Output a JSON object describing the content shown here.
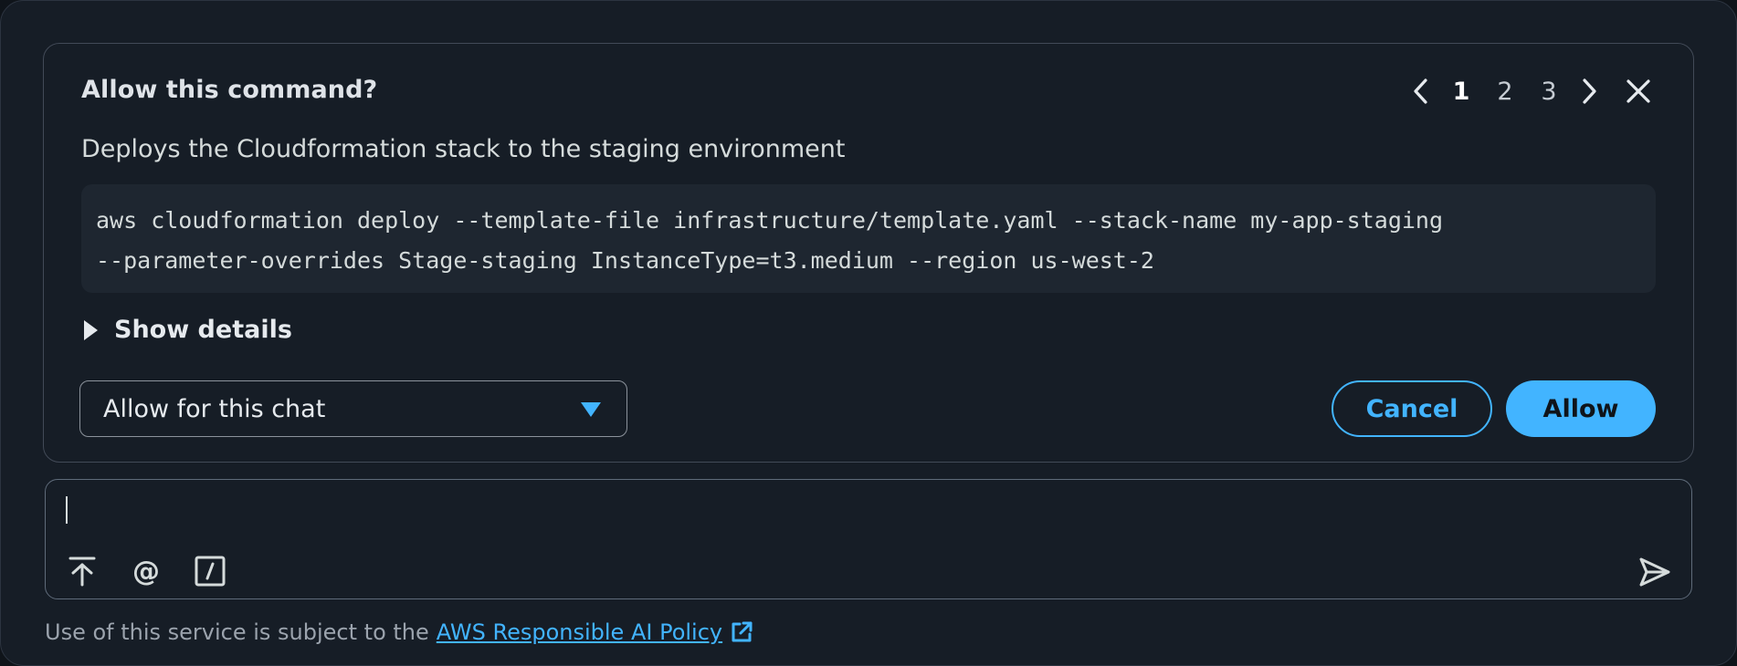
{
  "prompt": {
    "title": "Allow this command?",
    "description": "Deploys the Cloudformation stack to the staging environment",
    "command_line_1": "aws cloudformation deploy --template-file infrastructure/template.yaml --stack-name my-app-staging",
    "command_line_2": "--parameter-overrides Stage-staging InstanceType=t3.medium --region us-west-2",
    "details_label": "Show details",
    "pager": {
      "pages": [
        "1",
        "2",
        "3"
      ],
      "active_page": "1"
    },
    "scope_select": {
      "value": "Allow for this chat"
    },
    "cancel_label": "Cancel",
    "allow_label": "Allow"
  },
  "chat_input": {
    "value": "",
    "tools": [
      "upload-icon",
      "at-mention-icon",
      "slash-command-icon"
    ],
    "at_symbol": "@"
  },
  "footer": {
    "text": "Use of this service is subject to the",
    "link_label": "AWS Responsible AI Policy"
  },
  "colors": {
    "accent": "#42b4ff",
    "background": "#161d26",
    "code_background": "#1e2630"
  }
}
